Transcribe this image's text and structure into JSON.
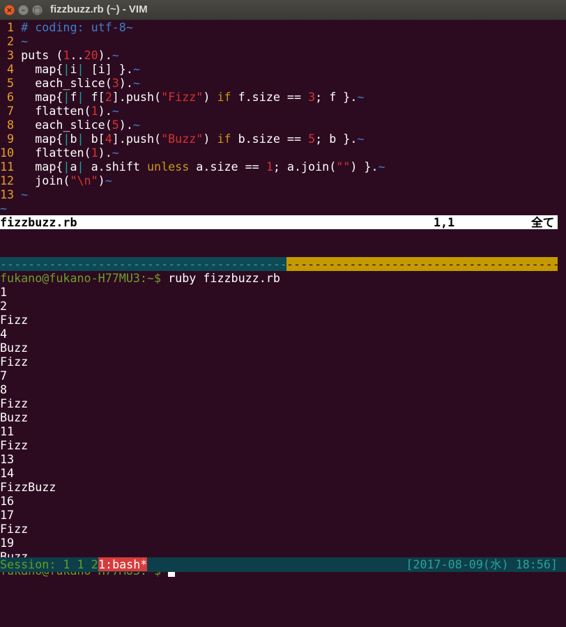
{
  "window": {
    "title": "fizzbuzz.rb (~) - VIM"
  },
  "vim": {
    "lines": [
      {
        "n": " 1",
        "segs": [
          [
            "cm",
            "# coding: utf-8"
          ],
          [
            "tl",
            "~"
          ]
        ]
      },
      {
        "n": " 2",
        "segs": [
          [
            "tl",
            "~"
          ]
        ]
      },
      {
        "n": " 3",
        "segs": [
          [
            "",
            "puts ("
          ],
          [
            "num",
            "1"
          ],
          [
            "",
            ".."
          ],
          [
            "num",
            "20"
          ],
          [
            "",
            ")."
          ],
          [
            "tl",
            "~"
          ]
        ]
      },
      {
        "n": " 4",
        "segs": [
          [
            "",
            "  map{"
          ],
          [
            "bar",
            "|"
          ],
          [
            "",
            "i"
          ],
          [
            "bar",
            "|"
          ],
          [
            "",
            " [i] }."
          ],
          [
            "tl",
            "~"
          ]
        ]
      },
      {
        "n": " 5",
        "segs": [
          [
            "",
            "  each_slice("
          ],
          [
            "num",
            "3"
          ],
          [
            "",
            ")."
          ],
          [
            "tl",
            "~"
          ]
        ]
      },
      {
        "n": " 6",
        "segs": [
          [
            "",
            "  map{"
          ],
          [
            "bar",
            "|"
          ],
          [
            "",
            "f"
          ],
          [
            "bar",
            "|"
          ],
          [
            "",
            " f["
          ],
          [
            "num",
            "2"
          ],
          [
            "",
            "].push("
          ],
          [
            "str",
            "\"Fizz\""
          ],
          [
            "",
            ") "
          ],
          [
            "kw",
            "if"
          ],
          [
            "",
            " f.size == "
          ],
          [
            "num",
            "3"
          ],
          [
            "",
            "; f }."
          ],
          [
            "tl",
            "~"
          ]
        ]
      },
      {
        "n": " 7",
        "segs": [
          [
            "",
            "  flatten("
          ],
          [
            "num",
            "1"
          ],
          [
            "",
            ")."
          ],
          [
            "tl",
            "~"
          ]
        ]
      },
      {
        "n": " 8",
        "segs": [
          [
            "",
            "  each_slice("
          ],
          [
            "num",
            "5"
          ],
          [
            "",
            ")."
          ],
          [
            "tl",
            "~"
          ]
        ]
      },
      {
        "n": " 9",
        "segs": [
          [
            "",
            "  map{"
          ],
          [
            "bar",
            "|"
          ],
          [
            "",
            "b"
          ],
          [
            "bar",
            "|"
          ],
          [
            "",
            " b["
          ],
          [
            "num",
            "4"
          ],
          [
            "",
            "].push("
          ],
          [
            "str",
            "\"Buzz\""
          ],
          [
            "",
            ") "
          ],
          [
            "kw",
            "if"
          ],
          [
            "",
            " b.size == "
          ],
          [
            "num",
            "5"
          ],
          [
            "",
            "; b }."
          ],
          [
            "tl",
            "~"
          ]
        ]
      },
      {
        "n": "10",
        "segs": [
          [
            "",
            "  flatten("
          ],
          [
            "num",
            "1"
          ],
          [
            "",
            ")."
          ],
          [
            "tl",
            "~"
          ]
        ]
      },
      {
        "n": "11",
        "segs": [
          [
            "",
            "  map{"
          ],
          [
            "bar",
            "|"
          ],
          [
            "",
            "a"
          ],
          [
            "bar",
            "|"
          ],
          [
            "",
            " a.shift "
          ],
          [
            "kw",
            "unless"
          ],
          [
            "",
            " a.size == "
          ],
          [
            "num",
            "1"
          ],
          [
            "",
            "; a.join("
          ],
          [
            "str",
            "\"\""
          ],
          [
            "",
            ") }."
          ],
          [
            "tl",
            "~"
          ]
        ]
      },
      {
        "n": "12",
        "segs": [
          [
            "",
            "  join("
          ],
          [
            "str",
            "\"\\n\""
          ],
          [
            "",
            ")"
          ],
          [
            "tl",
            "~"
          ]
        ]
      },
      {
        "n": "13",
        "segs": [
          [
            "tl",
            "~"
          ]
        ]
      }
    ],
    "tilde": "~",
    "status": {
      "file": "fizzbuzz.rb",
      "pos": "1,1",
      "scroll": "全て"
    },
    "separator": "----------------------------------------------------------------------------------------------------"
  },
  "shell": {
    "prompt": "fukano@fukano-H77MU3:~$ ",
    "command": "ruby fizzbuzz.rb",
    "output": [
      "1",
      "2",
      "Fizz",
      "4",
      "Buzz",
      "Fizz",
      "7",
      "8",
      "Fizz",
      "Buzz",
      "11",
      "Fizz",
      "13",
      "14",
      "FizzBuzz",
      "16",
      "17",
      "Fizz",
      "19",
      "Buzz"
    ]
  },
  "tmux": {
    "session": "Session: 1 1 2",
    "window": "1:bash*",
    "datetime": "[2017-08-09(水) 18:56]"
  },
  "colors": {
    "background": "#2c0b21",
    "line_number": "#e8a023",
    "prompt": "#6f9e2a",
    "tmux_active": "#d73b3b"
  }
}
